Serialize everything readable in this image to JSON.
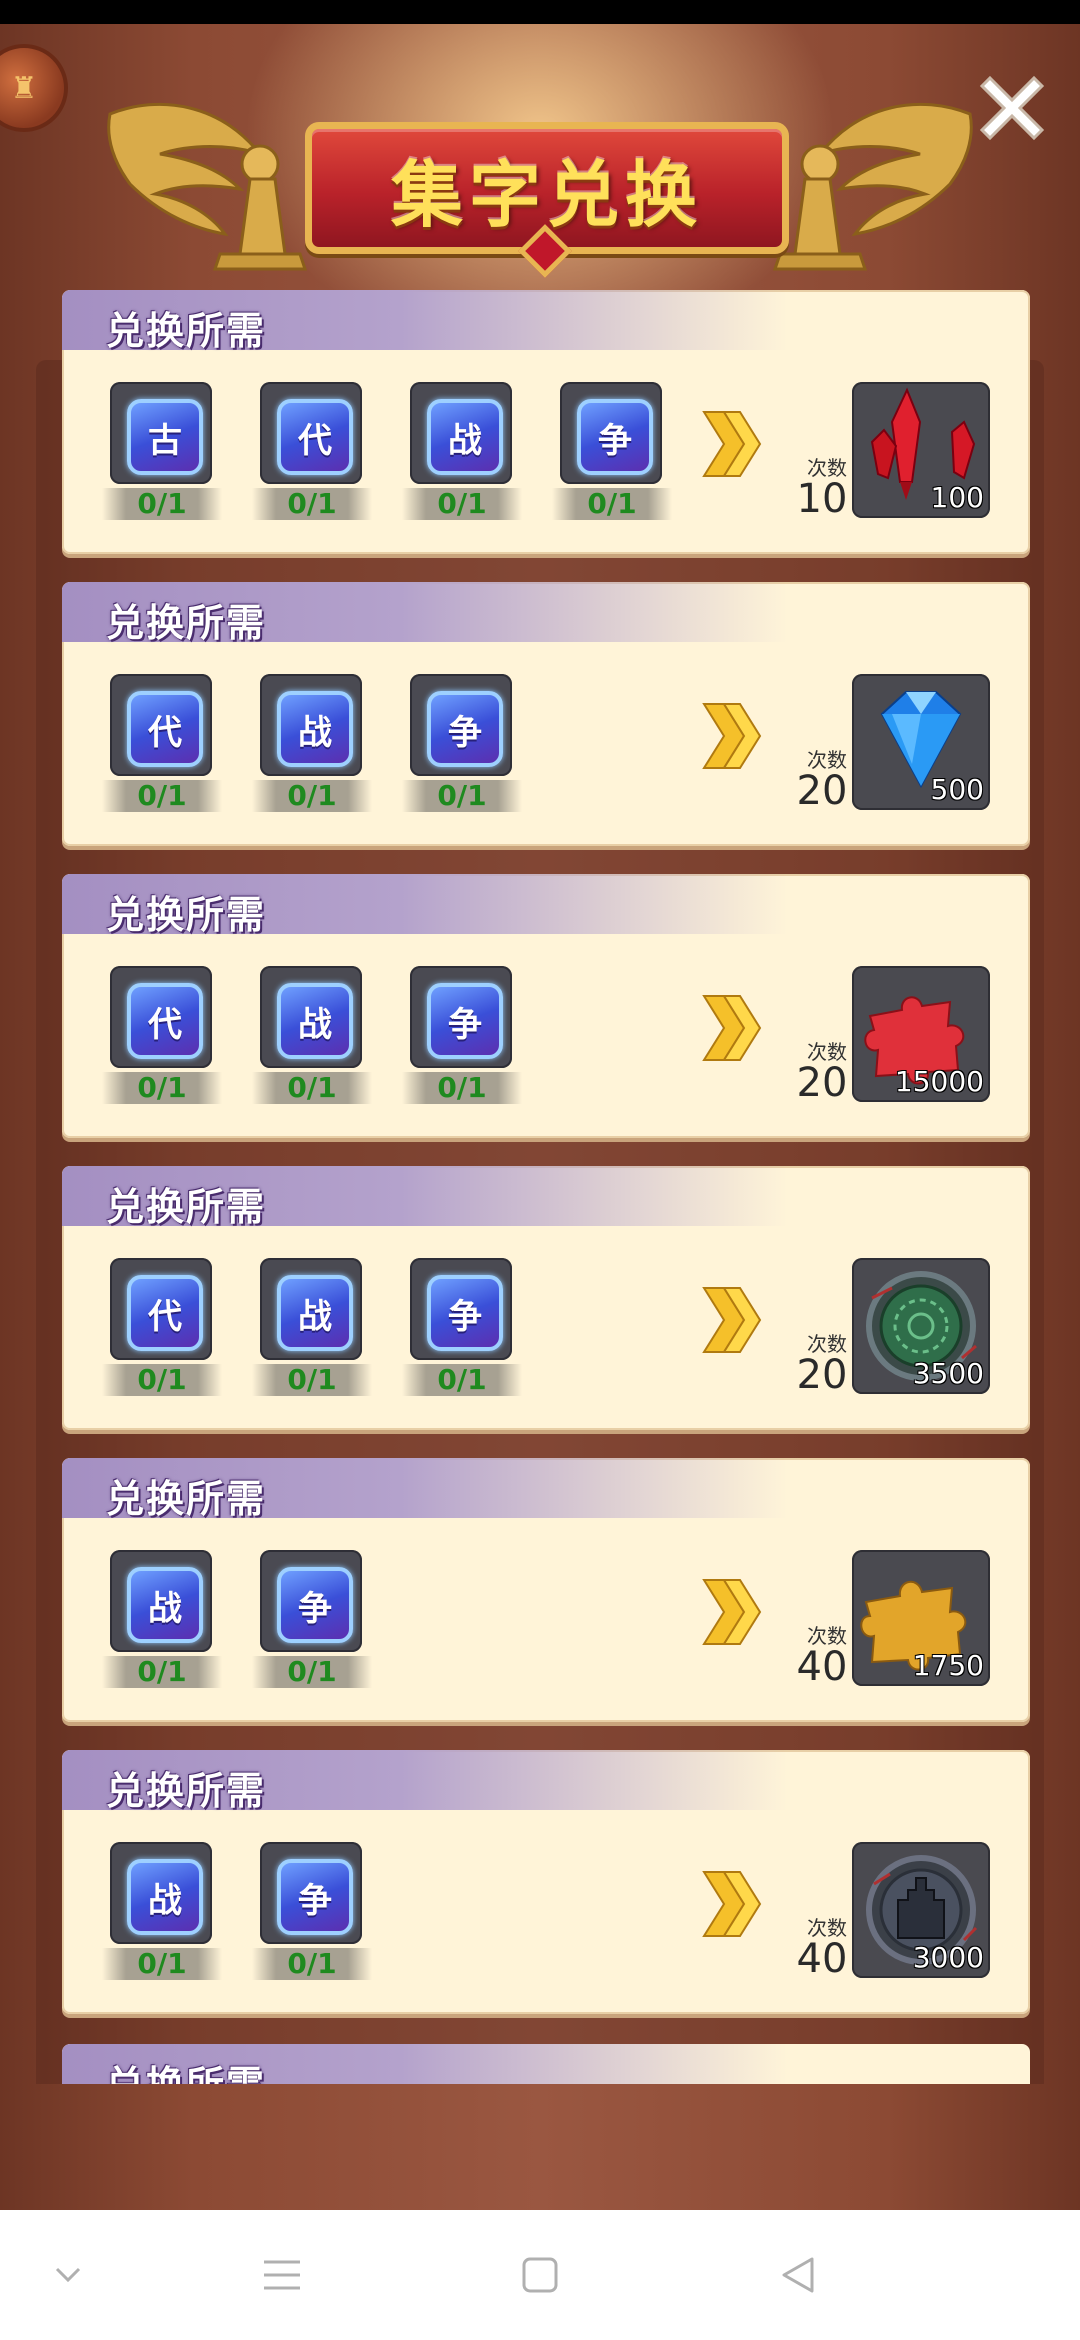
{
  "header": {
    "title": "集字兑换",
    "close_icon": "close-icon",
    "corner_icon": "treasure-chest-icon"
  },
  "colors": {
    "card_bg": "#fff4d8",
    "header_purple": "#a48fc2",
    "count_green": "#1f8a1f",
    "banner_red": "#b9222a",
    "gold": "#e8b552"
  },
  "cards": [
    {
      "title": "兑换所需",
      "chars": [
        {
          "char": "古",
          "count": "0/1"
        },
        {
          "char": "代",
          "count": "0/1"
        },
        {
          "char": "战",
          "count": "0/1"
        },
        {
          "char": "争",
          "count": "0/1"
        }
      ],
      "times_label": "次数",
      "times": "10",
      "reward": {
        "icon": "red-crystal-icon",
        "amount": "100"
      }
    },
    {
      "title": "兑换所需",
      "chars": [
        {
          "char": "代",
          "count": "0/1"
        },
        {
          "char": "战",
          "count": "0/1"
        },
        {
          "char": "争",
          "count": "0/1"
        }
      ],
      "times_label": "次数",
      "times": "20",
      "reward": {
        "icon": "blue-diamond-icon",
        "amount": "500"
      }
    },
    {
      "title": "兑换所需",
      "chars": [
        {
          "char": "代",
          "count": "0/1"
        },
        {
          "char": "战",
          "count": "0/1"
        },
        {
          "char": "争",
          "count": "0/1"
        }
      ],
      "times_label": "次数",
      "times": "20",
      "reward": {
        "icon": "red-puzzle-icon",
        "amount": "15000"
      }
    },
    {
      "title": "兑换所需",
      "chars": [
        {
          "char": "代",
          "count": "0/1"
        },
        {
          "char": "战",
          "count": "0/1"
        },
        {
          "char": "争",
          "count": "0/1"
        }
      ],
      "times_label": "次数",
      "times": "20",
      "reward": {
        "icon": "green-rune-icon",
        "amount": "3500"
      }
    },
    {
      "title": "兑换所需",
      "chars": [
        {
          "char": "战",
          "count": "0/1"
        },
        {
          "char": "争",
          "count": "0/1"
        }
      ],
      "times_label": "次数",
      "times": "40",
      "reward": {
        "icon": "gold-puzzle-icon",
        "amount": "1750"
      }
    },
    {
      "title": "兑换所需",
      "chars": [
        {
          "char": "战",
          "count": "0/1"
        },
        {
          "char": "争",
          "count": "0/1"
        }
      ],
      "times_label": "次数",
      "times": "40",
      "reward": {
        "icon": "castle-rune-icon",
        "amount": "3000"
      }
    }
  ],
  "peek_card": {
    "title": "兑换所需"
  },
  "navbar": {
    "icons": [
      "back-chevron-icon",
      "menu-icon",
      "home-square-icon",
      "back-triangle-icon"
    ]
  }
}
